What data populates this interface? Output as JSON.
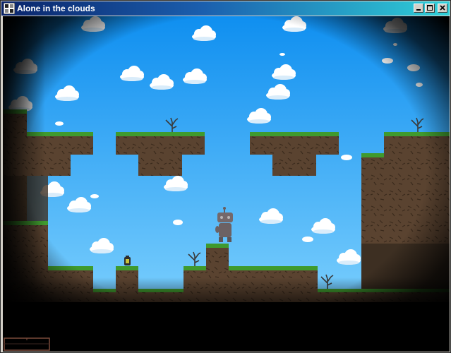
{
  "window": {
    "title": "Alone in the clouds",
    "minimize_icon": "minimize-icon",
    "maximize_icon": "maximize-icon",
    "close_icon": "close-icon"
  },
  "game": {
    "icons": [
      "dead-tree-icon",
      "robot-player-icon",
      "lantern-pickup-icon"
    ],
    "colors": {
      "sky_top": "#0f8ff0",
      "sky_bottom": "#8ad8ff",
      "dirt": "#5a4330",
      "dirt_shadow": "#3d2f22",
      "grass": "#3f9a2e",
      "grass_light": "#63c03f",
      "vignette": "#000000",
      "minimap_border": "#7a4a3a"
    }
  }
}
